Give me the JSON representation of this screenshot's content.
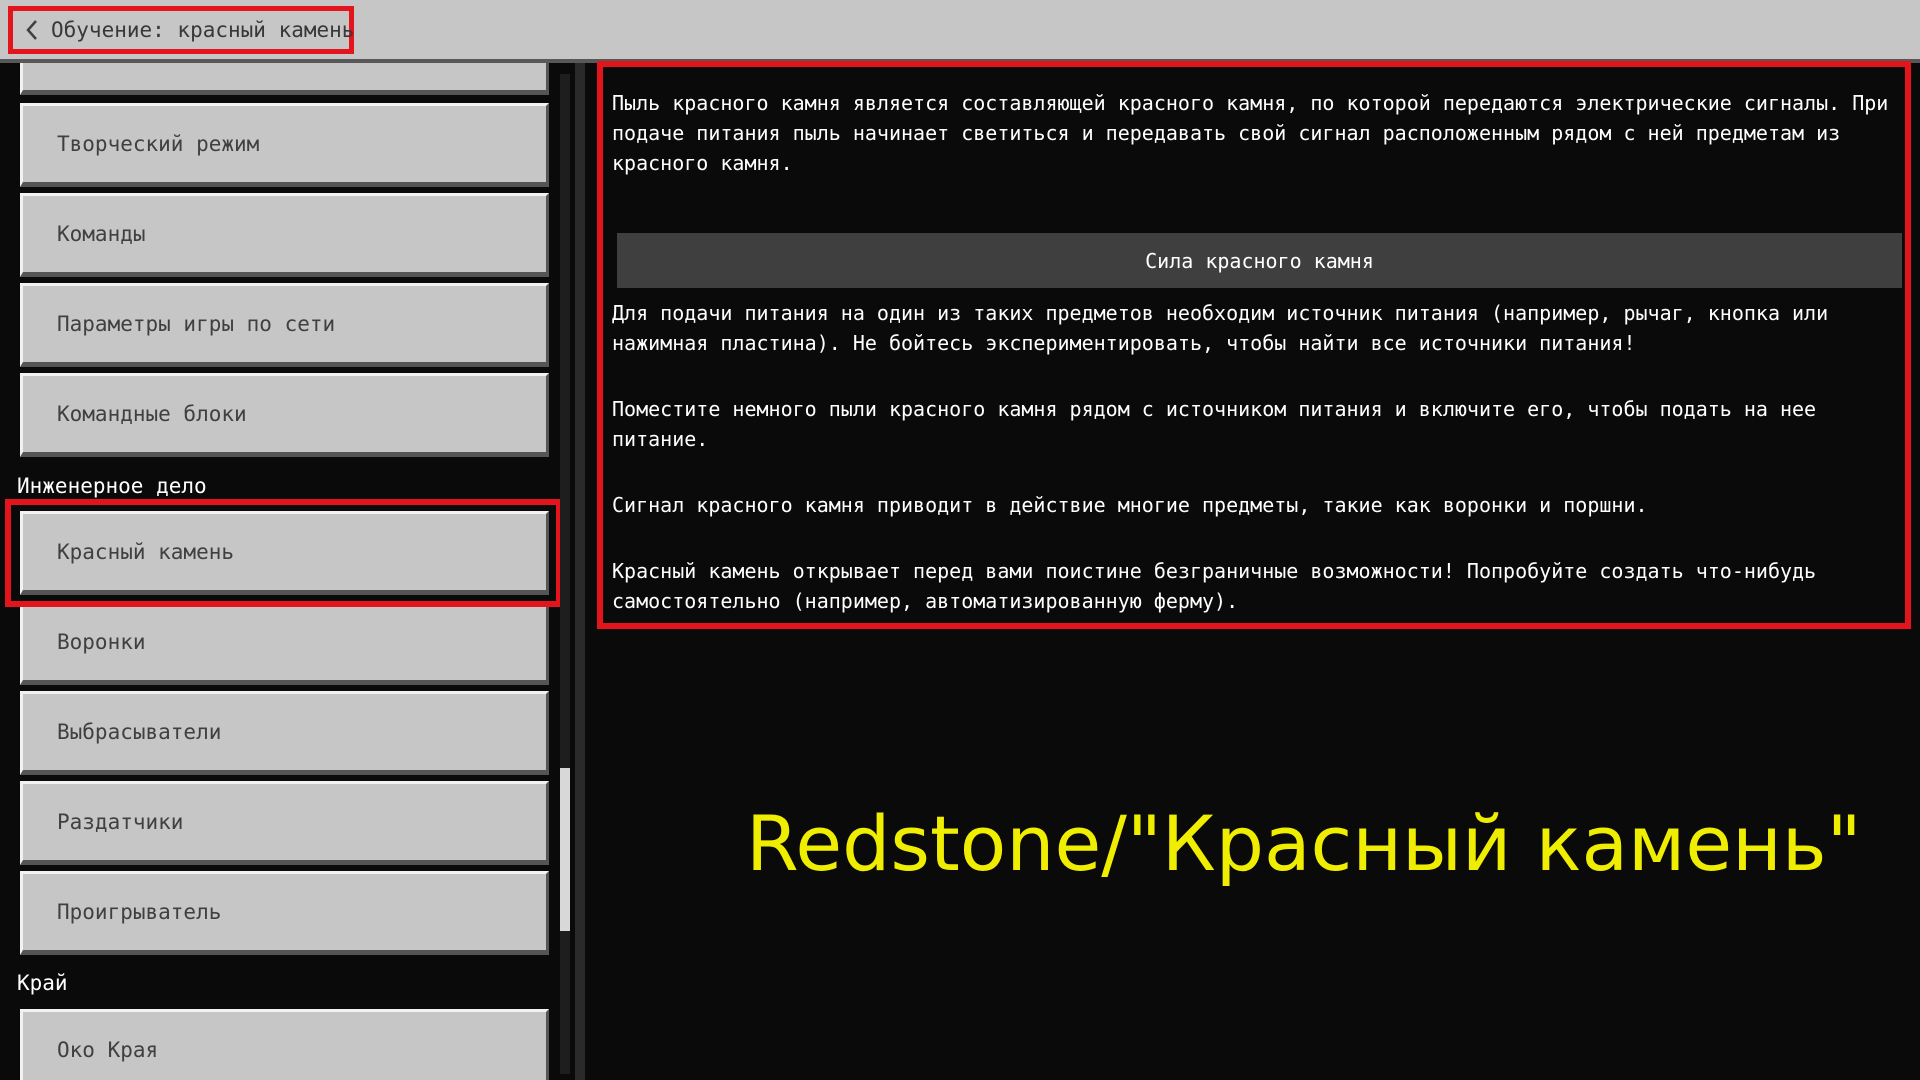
{
  "header": {
    "title": "Обучение: красный камень",
    "back_icon": "chevron-left-icon"
  },
  "sidebar": {
    "items": [
      {
        "label": ""
      },
      {
        "label": "Творческий режим"
      },
      {
        "label": "Команды"
      },
      {
        "label": "Параметры игры по сети"
      },
      {
        "label": "Командные блоки"
      },
      {
        "label": "Красный камень",
        "selected": true
      },
      {
        "label": "Воронки"
      },
      {
        "label": "Выбрасыватели"
      },
      {
        "label": "Раздатчики"
      },
      {
        "label": "Проигрыватель"
      },
      {
        "label": "Око Края"
      }
    ],
    "sections": [
      {
        "label": "Инженерное дело"
      },
      {
        "label": "Край"
      }
    ]
  },
  "content": {
    "intro": "Пыль красного камня является составляющей красного камня, по которой передаются электрические сигналы. При подаче питания пыль начинает светиться и передавать свой сигнал расположенным рядом с ней предметам из красного камня.",
    "subheader": "Сила красного камня",
    "paragraphs": [
      "Для подачи питания на один из таких предметов необходим источник питания (например, рычаг, кнопка или нажимная пластина). Не бойтесь экспериментировать, чтобы найти все источники питания!",
      "Поместите немного пыли красного камня рядом с источником питания и включите его, чтобы подать на нее питание.",
      "Сигнал красного камня приводит в действие многие предметы, такие как воронки и поршни.",
      "Красный камень открывает перед вами поистине безграничные возможности! Попробуйте создать что-нибудь самостоятельно (например, автоматизированную ферму)."
    ]
  },
  "caption": "Redstone/\"Красный камень\"",
  "colors": {
    "highlight": "#e3141b",
    "caption": "#f0ee00",
    "button": "#c6c6c6",
    "background": "#0a0a0a"
  }
}
